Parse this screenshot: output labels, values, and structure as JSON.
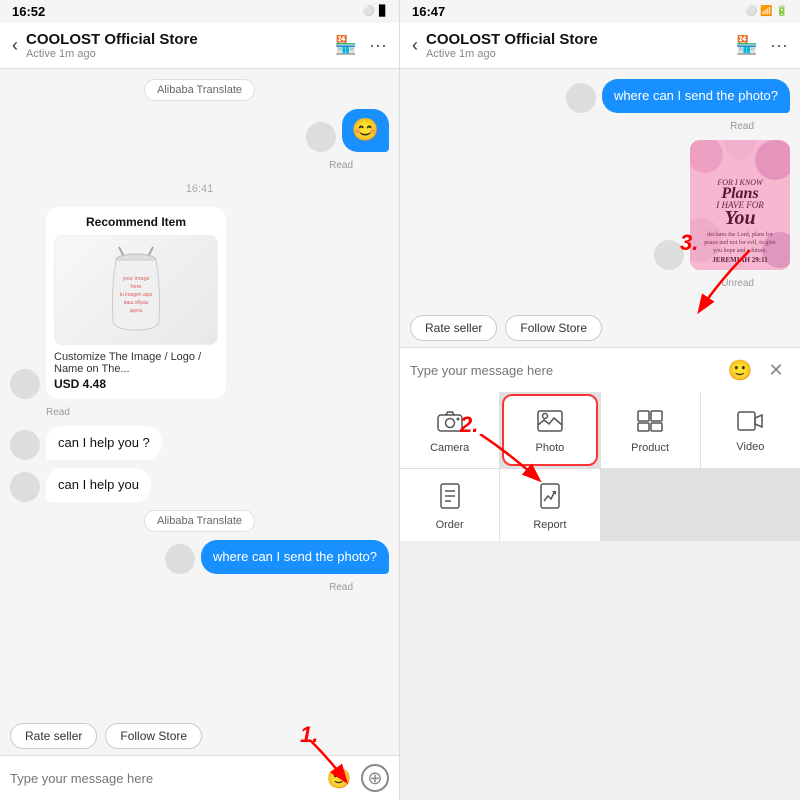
{
  "left": {
    "status": {
      "time": "16:52",
      "icons": "⚪ ⚫"
    },
    "header": {
      "title": "COOLOST Official Store",
      "status": "Active 1m ago",
      "back": "‹"
    },
    "translate_btn": "Alibaba Translate",
    "timestamp": "16:41",
    "recommend_card": {
      "title": "Recommend Item",
      "desc": "Customize The Image / Logo / Name on The...",
      "price": "USD 4.48",
      "img_text": "your image\nhere\ntu imagen aqui\nваш образ\nздесь"
    },
    "read": "Read",
    "messages": [
      {
        "text": "can I help you ?",
        "type": "left"
      },
      {
        "text": "can I help you",
        "type": "left"
      },
      {
        "text": "where can I send the photo?",
        "type": "right"
      }
    ],
    "translate_btn2": "Alibaba Translate",
    "read2": "Read",
    "action_btns": [
      "Rate seller",
      "Follow Store"
    ],
    "input_placeholder": "Type your message here",
    "annotation1": "1.",
    "annotation1_label": "plus button"
  },
  "right": {
    "status": {
      "time": "16:47",
      "icons": "⚪ 📶 🔋"
    },
    "header": {
      "title": "COOLOST Official Store",
      "status": "Active 1m ago",
      "back": "‹"
    },
    "messages": [
      {
        "text": "where can I send the photo?",
        "type": "right"
      },
      {
        "read": "Read"
      },
      {
        "unread": "Unread"
      }
    ],
    "action_btns": [
      "Rate seller",
      "Follow Store"
    ],
    "input_placeholder": "Type your message here",
    "grid": [
      {
        "icon": "📷",
        "label": "Camera",
        "id": "camera"
      },
      {
        "icon": "🖼",
        "label": "Photo",
        "id": "photo",
        "highlighted": true
      },
      {
        "icon": "⊞",
        "label": "Product",
        "id": "product"
      },
      {
        "icon": "🎬",
        "label": "Video",
        "id": "video"
      },
      {
        "icon": "📋",
        "label": "Order",
        "id": "order"
      },
      {
        "icon": "📝",
        "label": "Report",
        "id": "report"
      }
    ],
    "annotation2": "2.",
    "annotation3": "3."
  }
}
